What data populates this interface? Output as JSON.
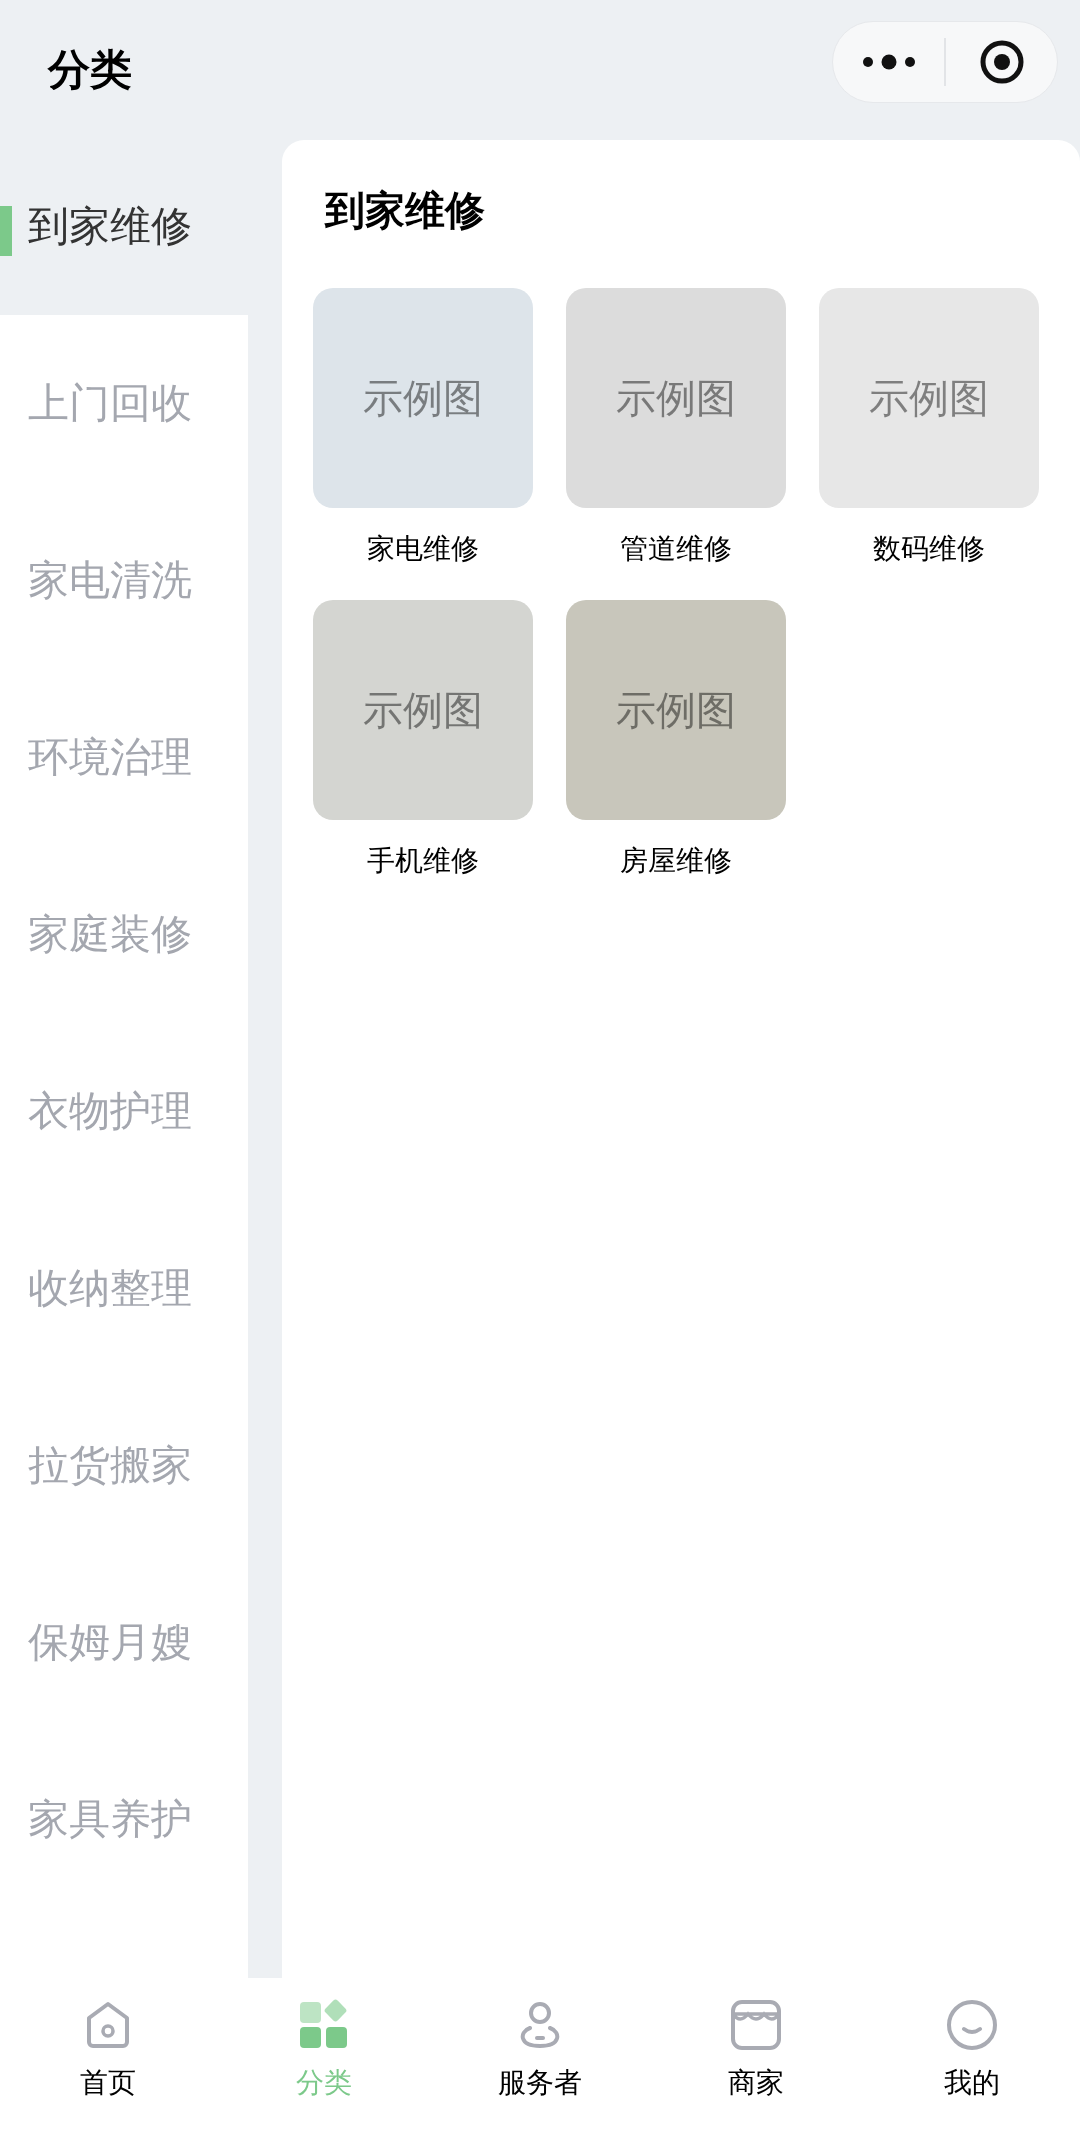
{
  "header": {
    "title": "分类"
  },
  "sidebar": {
    "items": [
      {
        "label": "到家维修",
        "selected": true
      },
      {
        "label": "上门回收",
        "selected": false
      },
      {
        "label": "家电清洗",
        "selected": false
      },
      {
        "label": "环境治理",
        "selected": false
      },
      {
        "label": "家庭装修",
        "selected": false
      },
      {
        "label": "衣物护理",
        "selected": false
      },
      {
        "label": "收纳整理",
        "selected": false
      },
      {
        "label": "拉货搬家",
        "selected": false
      },
      {
        "label": "保姆月嫂",
        "selected": false
      },
      {
        "label": "家具养护",
        "selected": false
      }
    ]
  },
  "content": {
    "heading": "到家维修",
    "tiles": [
      {
        "image_text": "示例图",
        "label": "家电维修",
        "color": "#dde4ea"
      },
      {
        "image_text": "示例图",
        "label": "管道维修",
        "color": "#dcdcdc"
      },
      {
        "image_text": "示例图",
        "label": "数码维修",
        "color": "#e7e7e7"
      },
      {
        "image_text": "示例图",
        "label": "手机维修",
        "color": "#d4d5d1"
      },
      {
        "image_text": "示例图",
        "label": "房屋维修",
        "color": "#c8c6bb"
      }
    ]
  },
  "tab_bar": [
    {
      "kind": "home",
      "label": "首页",
      "selected": false
    },
    {
      "kind": "category",
      "label": "分类",
      "selected": true
    },
    {
      "kind": "provider",
      "label": "服务者",
      "selected": false
    },
    {
      "kind": "shop",
      "label": "商家",
      "selected": false
    },
    {
      "kind": "me",
      "label": "我的",
      "selected": false
    }
  ]
}
